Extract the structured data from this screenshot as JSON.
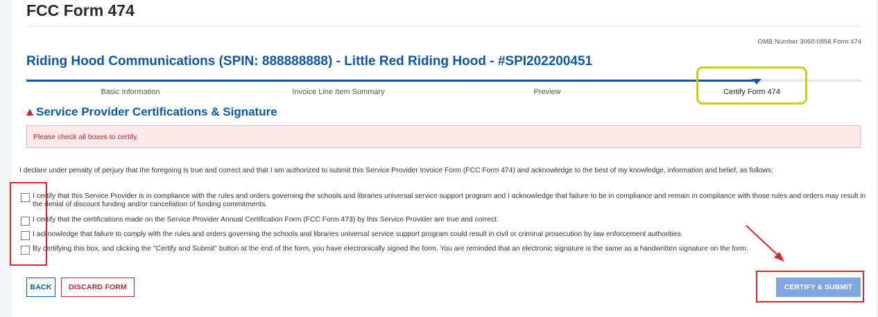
{
  "form_title": "FCC Form 474",
  "omb_text": "OMB Number 3060-0856 Form 474",
  "entity_title": "Riding Hood Communications (SPIN: 888888888) - Little Red Riding Hood - #SPI202200451",
  "steps": [
    {
      "label": "Basic Information"
    },
    {
      "label": "Invoice Line Item Summary"
    },
    {
      "label": "Preview"
    },
    {
      "label": "Certify Form 474"
    }
  ],
  "section_heading": "Service Provider Certifications & Signature",
  "alert_text": "Please check all boxes to certify.",
  "declaration": "I declare under penalty of perjury that the foregoing is true and correct and that I am authorized to submit this Service Provider Invoice Form (FCC Form 474) and acknowledge to the best of my knowledge, information and belief, as follows:",
  "certifications": [
    {
      "text": "I certify that this Service Provider is in compliance with the rules and orders governing the schools and libraries universal service support program and I acknowledge that failure to be in compliance and remain in compliance with those rules and orders may result in the denial of discount funding and/or cancellation of funding commitments.",
      "checked": false
    },
    {
      "text": "I certify that the certifications made on the Service Provider Annual Certification Form (FCC Form 473) by this Service Provider are true and correct.",
      "checked": false
    },
    {
      "text": "I acknowledge that failure to comply with the rules and orders governing the schools and libraries universal service support program could result in civil or criminal prosecution by law enforcement authorities.",
      "checked": false
    },
    {
      "text": "By certifying this box, and clicking the \"Certify and Submit\" button at the end of the form, you have electronically signed the form. You are reminded that an electronic signature is the same as a handwritten signature on the form.",
      "checked": false
    }
  ],
  "buttons": {
    "back": "BACK",
    "discard": "DISCARD FORM",
    "submit": "CERTIFY & SUBMIT"
  },
  "colors": {
    "brand_blue": "#0b57a8",
    "alert_red": "#c0272d",
    "highlight_yellow": "#c9cc1a",
    "annotation_red": "#d6272d"
  }
}
